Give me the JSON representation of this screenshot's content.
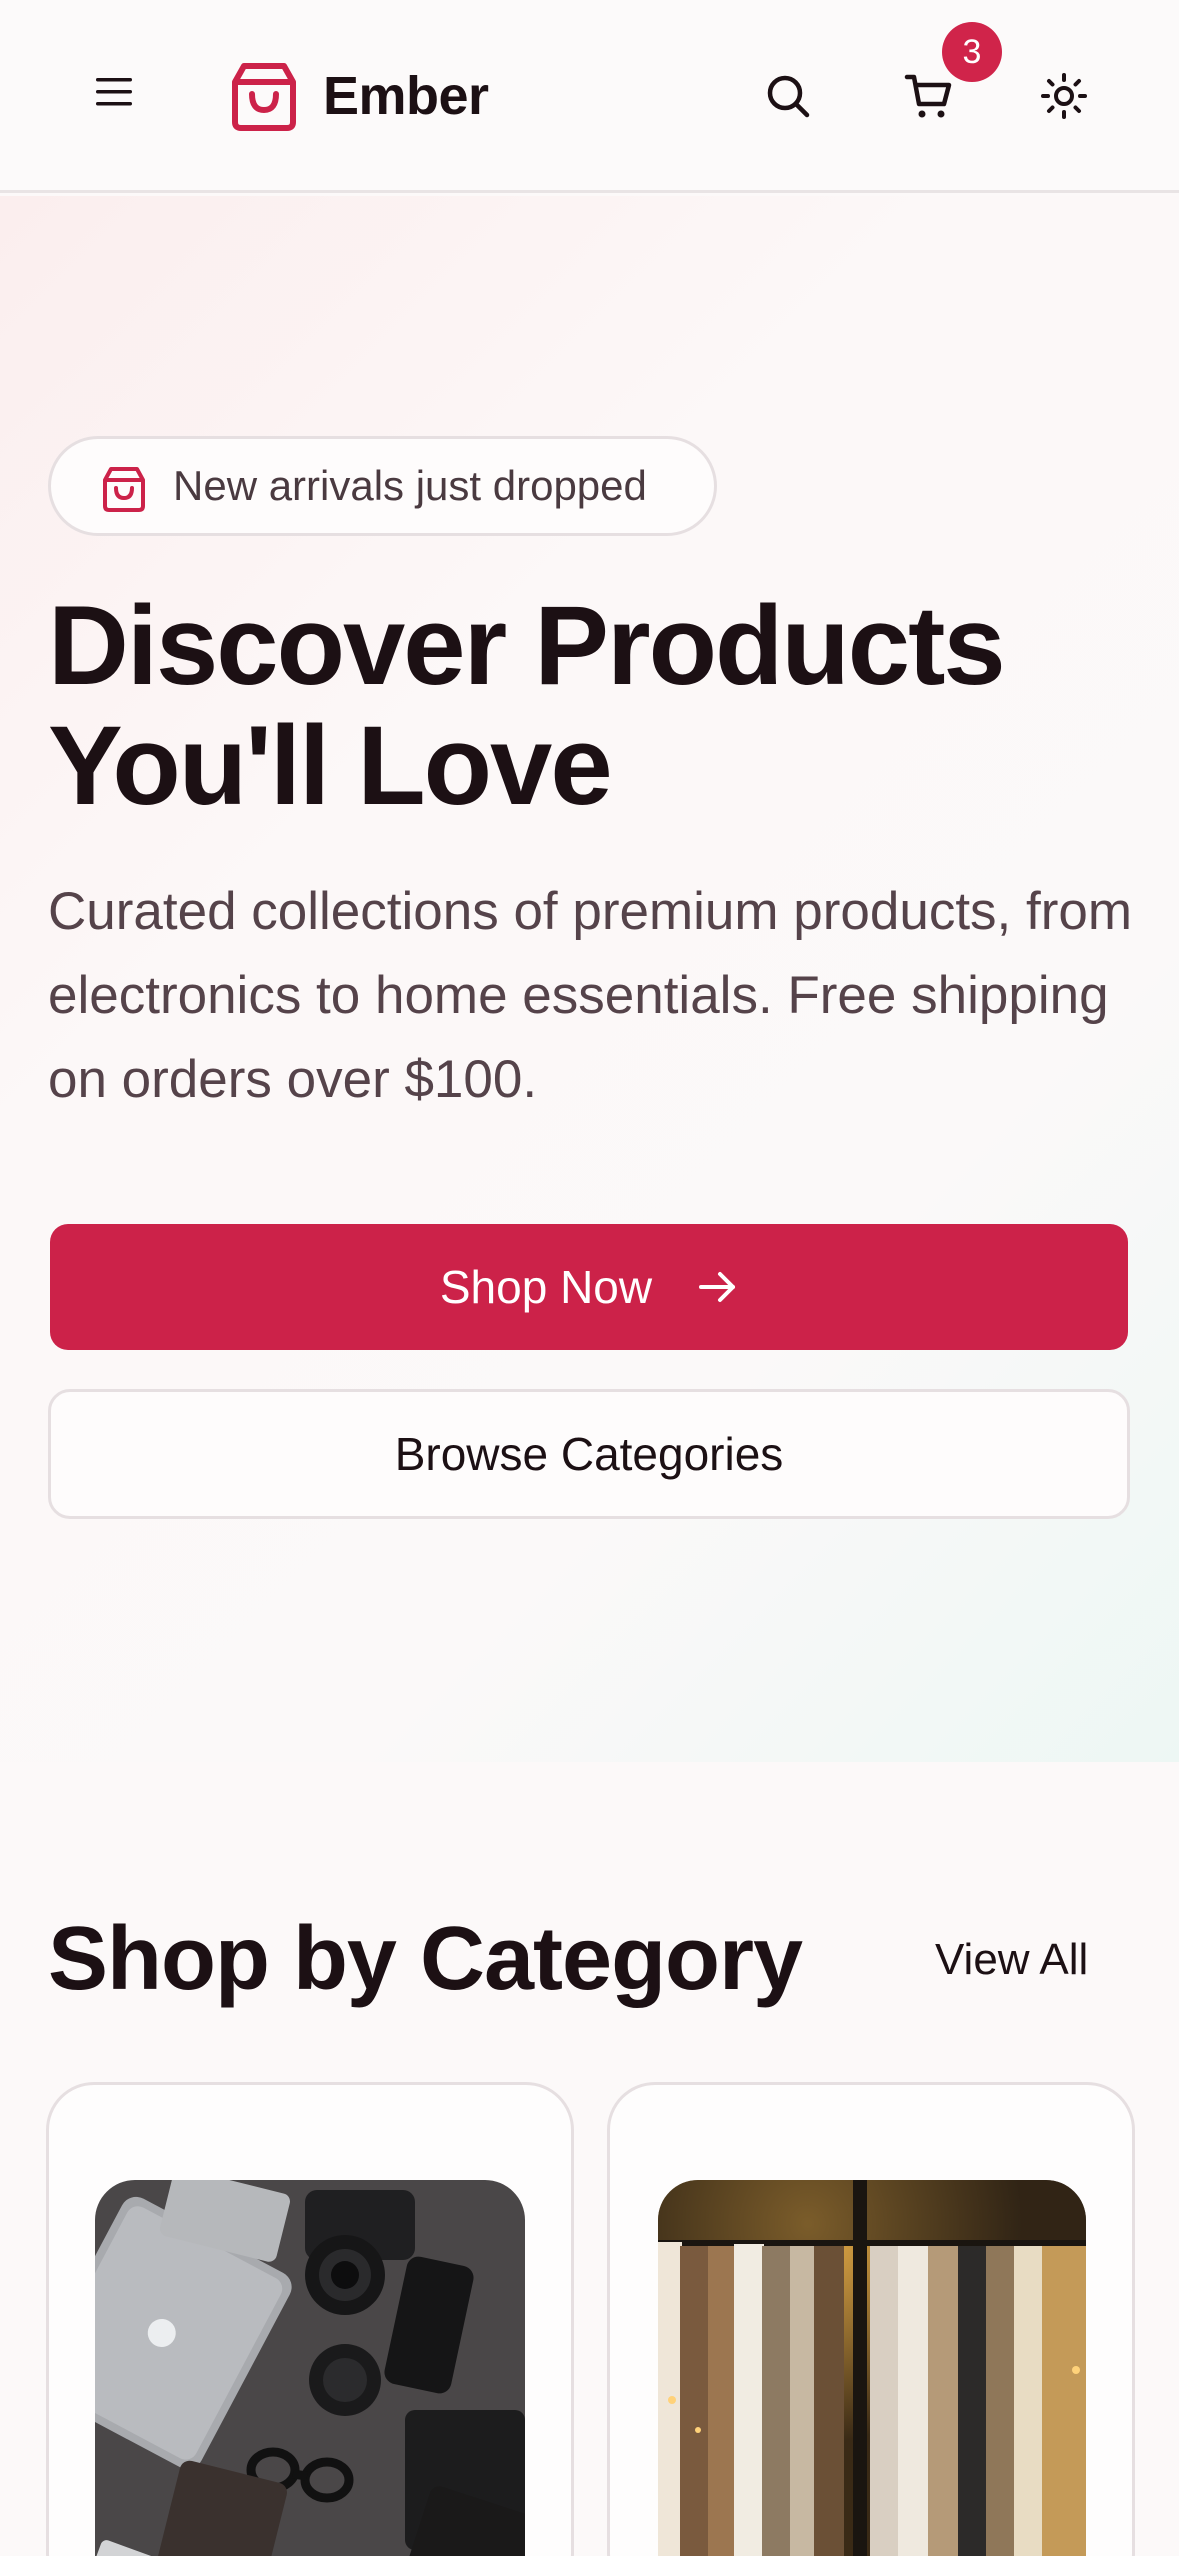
{
  "header": {
    "brand": "Ember",
    "cart_count": "3",
    "icons": [
      "menu-icon",
      "shopping-bag-icon",
      "search-icon",
      "cart-icon",
      "sun-icon"
    ]
  },
  "hero": {
    "badge": "New arrivals just dropped",
    "title_line1": "Discover Products",
    "title_line2": "You'll Love",
    "description": "Curated collections of premium products, from electronics to home essentials. Free shipping on orders over $100.",
    "primary_button": "Shop Now",
    "secondary_button": "Browse Categories"
  },
  "categories": {
    "title": "Shop by Category",
    "view_all": "View All",
    "cards": [
      {
        "image": "electronics-flatlay-photo"
      },
      {
        "image": "clothing-rack-photo"
      }
    ]
  },
  "colors": {
    "accent": "#cc2249",
    "text": "#1c1014",
    "muted": "#55434a",
    "border": "#e6dfe1"
  }
}
